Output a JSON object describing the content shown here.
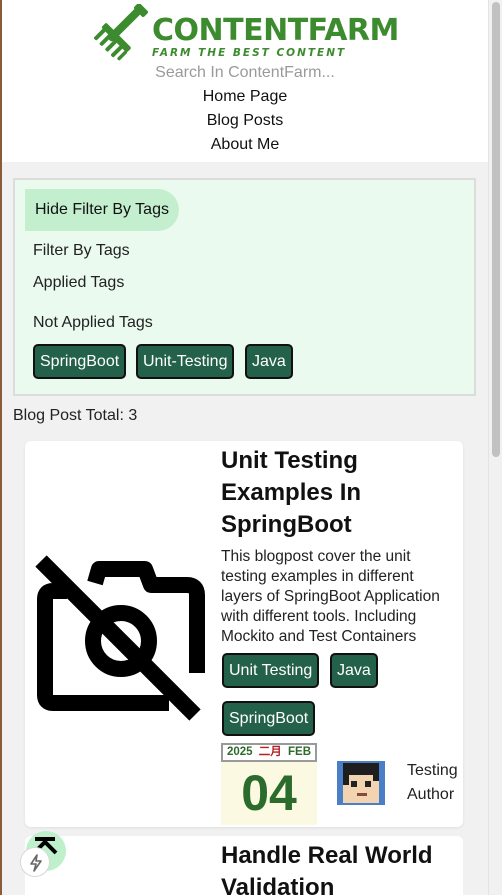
{
  "header": {
    "logo_title": "CONTENTFARM",
    "logo_tagline": "FARM THE BEST CONTENT",
    "search_placeholder": "Search In ContentFarm..."
  },
  "nav": [
    "Home Page",
    "Blog Posts",
    "About Me"
  ],
  "filter": {
    "toggle_label": "Hide Filter By Tags",
    "filter_label": "Filter By Tags",
    "applied_label": "Applied Tags",
    "not_applied_label": "Not Applied Tags",
    "not_applied_tags": [
      "SpringBoot",
      "Unit-Testing",
      "Java"
    ]
  },
  "total_label": "Blog Post Total: 3",
  "posts": [
    {
      "title": "Unit Testing Examples In SpringBoot",
      "description": "This blogpost cover the unit testing examples in different layers of SpringBoot Application with different tools. Including Mockito and Test Containers",
      "tags": [
        "Unit Testing",
        "Java",
        "SpringBoot"
      ],
      "date": {
        "year": "2025",
        "month_cn": "二月",
        "month": "FEB",
        "day": "04"
      },
      "author": "Testing Author"
    },
    {
      "title": "Handle Real World Validation"
    }
  ],
  "colors": {
    "brand_green": "#3d8b2f",
    "tag_bg": "#24614a",
    "filter_bg": "#eafaee",
    "toggle_bg": "#c3efcf"
  },
  "icons": {
    "logo": "rake-icon",
    "no_image": "camera-off-icon",
    "scroll_top": "arrow-up-bar-icon",
    "flash": "lightning-icon"
  }
}
